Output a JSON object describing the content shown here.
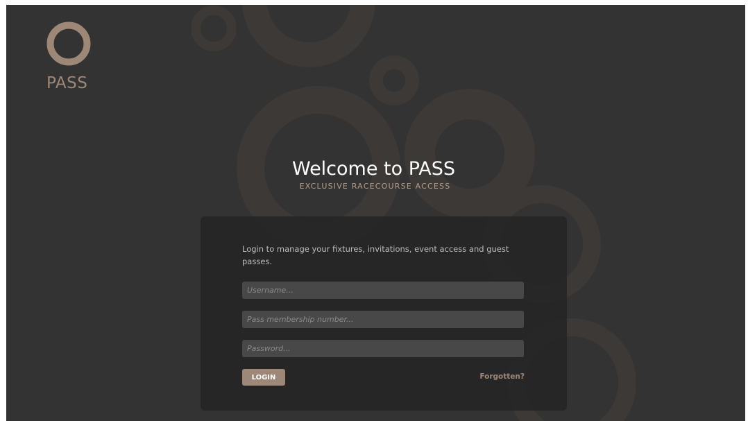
{
  "brand": {
    "logo_text": "PASS",
    "accent_color": "#9d8877",
    "background_color": "#333333"
  },
  "hero": {
    "title": "Welcome to PASS",
    "subtitle": "EXCLUSIVE RACECOURSE ACCESS"
  },
  "login_card": {
    "intro": "Login to manage your fixtures, invitations, event access and guest passes.",
    "fields": {
      "username": {
        "value": "",
        "placeholder": "Username..."
      },
      "membership": {
        "value": "",
        "placeholder": "Pass membership number..."
      },
      "password": {
        "value": "",
        "placeholder": "Password..."
      }
    },
    "login_label": "LOGIN",
    "forgotten_label": "Forgotten?"
  },
  "icons": {
    "logo": "ring-logo-icon",
    "background": "decorative-ring-icons"
  }
}
